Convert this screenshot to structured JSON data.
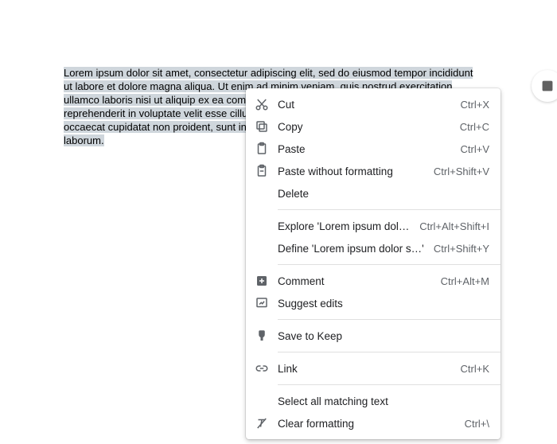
{
  "document": {
    "selected_text": "Lorem ipsum dolor sit amet, consectetur adipiscing elit, sed do eiusmod tempor incididunt ut labore et dolore magna aliqua. Ut enim ad minim veniam, quis nostrud exercitation ullamco laboris nisi ut aliquip ex ea commodo consequat. Duis aute irure dolor in reprehenderit in voluptate velit esse cillum dolore eu fugiat nulla pariatur. Excepteur sint occaecat cupidatat non proident, sunt in culpa qui officia deserunt mollit anim id est laborum."
  },
  "menu": {
    "items": [
      {
        "label": "Cut",
        "shortcut": "Ctrl+X"
      },
      {
        "label": "Copy",
        "shortcut": "Ctrl+C"
      },
      {
        "label": "Paste",
        "shortcut": "Ctrl+V"
      },
      {
        "label": "Paste without formatting",
        "shortcut": "Ctrl+Shift+V"
      },
      {
        "label": "Delete",
        "shortcut": ""
      },
      {
        "label": "Explore 'Lorem ipsum dolor s…'",
        "shortcut": "Ctrl+Alt+Shift+I"
      },
      {
        "label": "Define 'Lorem ipsum dolor s…'",
        "shortcut": "Ctrl+Shift+Y"
      },
      {
        "label": "Comment",
        "shortcut": "Ctrl+Alt+M"
      },
      {
        "label": "Suggest edits",
        "shortcut": ""
      },
      {
        "label": "Save to Keep",
        "shortcut": ""
      },
      {
        "label": "Link",
        "shortcut": "Ctrl+K"
      },
      {
        "label": "Select all matching text",
        "shortcut": ""
      },
      {
        "label": "Clear formatting",
        "shortcut": "Ctrl+\\"
      }
    ]
  }
}
